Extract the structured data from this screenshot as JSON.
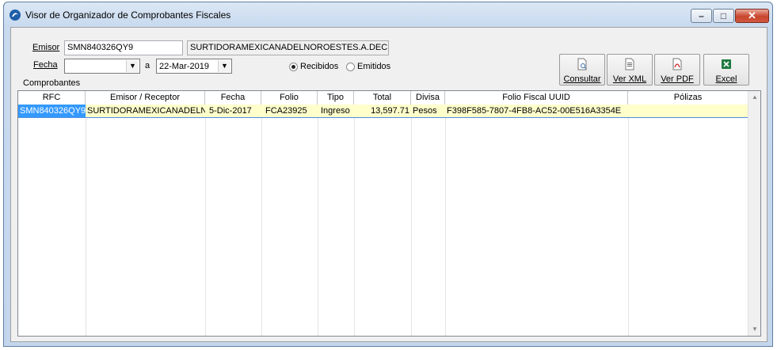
{
  "window": {
    "title": "Visor de Organizador de Comprobantes Fiscales"
  },
  "filters": {
    "emisor_label": "Emisor",
    "emisor_rfc": "SMN840326QY9",
    "emisor_name": "SURTIDORAMEXICANADELNOROESTES.A.DEC.V.",
    "fecha_label": "Fecha",
    "fecha_from": "",
    "a_label": "a",
    "fecha_to": "22-Mar-2019",
    "radio_recibidos": "Recibidos",
    "radio_emitidos": "Emitidos",
    "selected_radio": "Recibidos"
  },
  "toolbar": {
    "consultar": "Consultar",
    "ver_xml": "Ver XML",
    "ver_pdf": "Ver PDF",
    "excel": "Excel"
  },
  "grid": {
    "section_label": "Comprobantes",
    "columns": [
      "RFC",
      "Emisor / Receptor",
      "Fecha",
      "Folio",
      "Tipo",
      "Total",
      "Divisa",
      "Folio Fiscal UUID",
      "Pólizas"
    ],
    "rows": [
      [
        "SMN840326QY9",
        "SURTIDORAMEXICANADELNOI",
        "5-Dic-2017",
        "FCA23925",
        "Ingreso",
        "13,597.71",
        "Pesos",
        "F398F585-7807-4FB8-AC52-00E516A3354E",
        ""
      ]
    ]
  }
}
